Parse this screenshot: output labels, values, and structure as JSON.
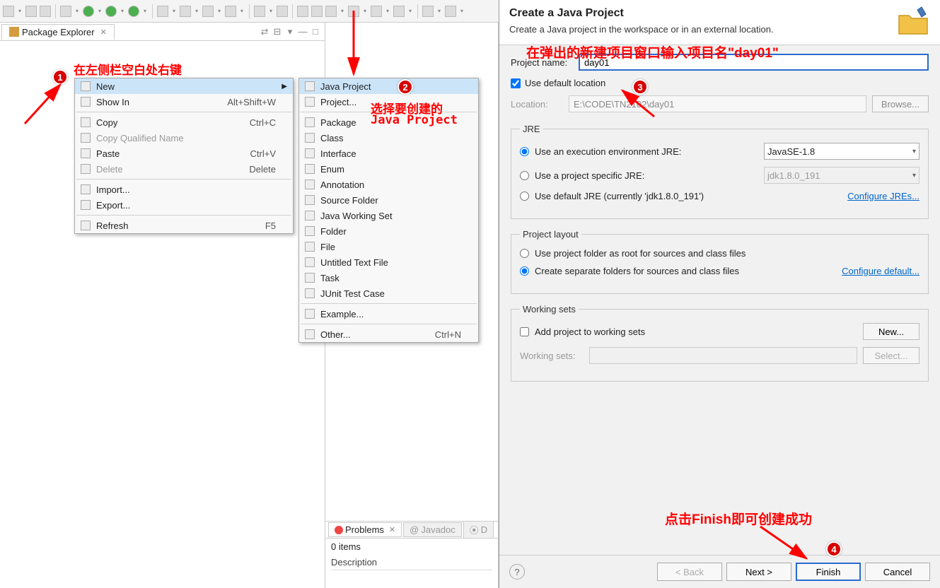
{
  "packageExplorer": {
    "title": "Package Explorer"
  },
  "contextMenu": {
    "items": [
      {
        "label": "New",
        "accel": "",
        "arrow": true,
        "highlight": true
      },
      {
        "label": "Show In",
        "accel": "Alt+Shift+W"
      },
      {
        "sep": true
      },
      {
        "label": "Copy",
        "accel": "Ctrl+C"
      },
      {
        "label": "Copy Qualified Name",
        "accel": "",
        "disabled": true
      },
      {
        "label": "Paste",
        "accel": "Ctrl+V"
      },
      {
        "label": "Delete",
        "accel": "Delete",
        "disabled": true
      },
      {
        "sep": true
      },
      {
        "label": "Import...",
        "accel": ""
      },
      {
        "label": "Export...",
        "accel": ""
      },
      {
        "sep": true
      },
      {
        "label": "Refresh",
        "accel": "F5"
      }
    ]
  },
  "subMenu": {
    "items": [
      {
        "label": "Java Project",
        "highlight": true
      },
      {
        "label": "Project..."
      },
      {
        "sep": true
      },
      {
        "label": "Package"
      },
      {
        "label": "Class"
      },
      {
        "label": "Interface"
      },
      {
        "label": "Enum"
      },
      {
        "label": "Annotation"
      },
      {
        "label": "Source Folder"
      },
      {
        "label": "Java Working Set"
      },
      {
        "label": "Folder"
      },
      {
        "label": "File"
      },
      {
        "label": "Untitled Text File"
      },
      {
        "label": "Task"
      },
      {
        "label": "JUnit Test Case"
      },
      {
        "sep": true
      },
      {
        "label": "Example..."
      },
      {
        "sep": true
      },
      {
        "label": "Other...",
        "accel": "Ctrl+N"
      }
    ]
  },
  "bottomTabs": {
    "problems": "Problems",
    "javadoc": "Javadoc",
    "declaration": "D",
    "items": "0 items",
    "description": "Description"
  },
  "wizard": {
    "title": "Create a Java Project",
    "desc": "Create a Java project in the workspace or in an external location.",
    "projectNameLabel": "Project name:",
    "projectNameValue": "day01",
    "useDefaultLocation": "Use default location",
    "locationLabel": "Location:",
    "locationValue": "E:\\CODE\\TN2102\\day01",
    "browse": "Browse...",
    "jre": {
      "legend": "JRE",
      "opt1": "Use an execution environment JRE:",
      "opt1val": "JavaSE-1.8",
      "opt2": "Use a project specific JRE:",
      "opt2val": "jdk1.8.0_191",
      "opt3": "Use default JRE (currently 'jdk1.8.0_191')",
      "configure": "Configure JREs..."
    },
    "layout": {
      "legend": "Project layout",
      "opt1": "Use project folder as root for sources and class files",
      "opt2": "Create separate folders for sources and class files",
      "configure": "Configure default..."
    },
    "ws": {
      "legend": "Working sets",
      "add": "Add project to working sets",
      "new": "New...",
      "label": "Working sets:",
      "select": "Select..."
    },
    "buttons": {
      "back": "< Back",
      "next": "Next >",
      "finish": "Finish",
      "cancel": "Cancel"
    }
  },
  "annotations": {
    "a1": "在左侧栏空白处右键",
    "a2a": "选择要创建的",
    "a2b": "Java Project",
    "a3": "在弹出的新建项目窗口输入项目名\"day01\"",
    "a4": "点击Finish即可创建成功"
  }
}
